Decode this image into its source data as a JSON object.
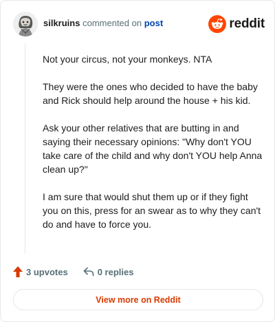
{
  "header": {
    "username": "silkruins",
    "action_text": "commented on",
    "post_link": "post",
    "brand": "reddit"
  },
  "comment": {
    "paragraphs": [
      "Not your circus, not your monkeys. NTA",
      "They were the ones who decided to have the baby and Rick should help around the house + his kid.",
      "Ask your other relatives that are butting in and saying their necessary opinions: \"Why don't YOU take care of the child and why don't YOU help Anna clean up?\"",
      "I am sure that would shut them up or if they fight you on this, press for an swear as to why they can't do and have to force you."
    ]
  },
  "actions": {
    "upvotes": "3 upvotes",
    "replies": "0 replies"
  },
  "footer": {
    "view_more": "View more on Reddit"
  },
  "colors": {
    "brand_orange": "#ff4500",
    "upvote_orange": "#d93a00",
    "link_blue": "#0045ac",
    "meta_gray": "#576f76"
  },
  "icons": {
    "avatar": "avatar-sketch-icon",
    "logo": "reddit-snoo-icon",
    "upvote": "upvote-arrow-icon",
    "reply": "reply-arrow-icon"
  }
}
